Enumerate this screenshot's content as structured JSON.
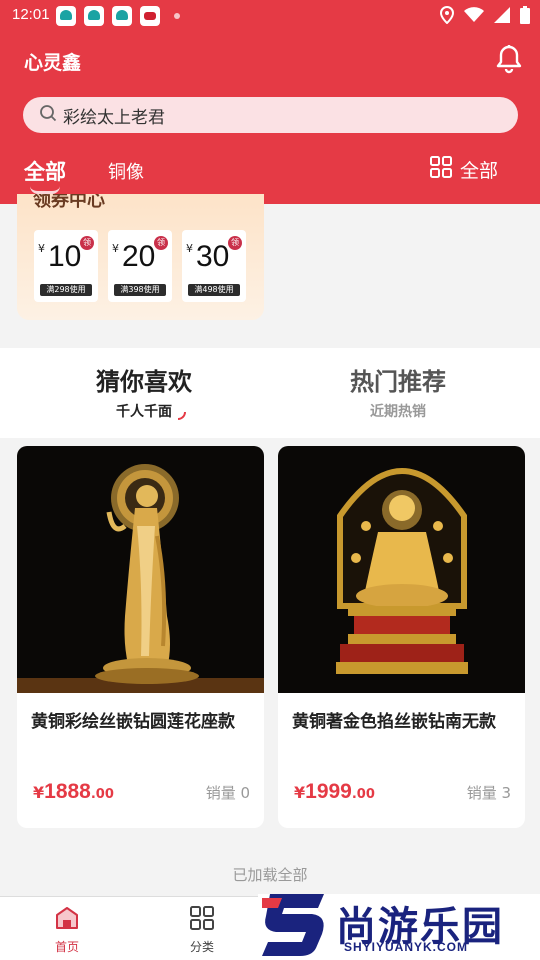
{
  "status": {
    "time": "12:01"
  },
  "header": {
    "title": "心灵鑫",
    "search_value": "彩绘太上老君",
    "tabs": [
      "全部",
      "铜像"
    ],
    "grid_label": "全部"
  },
  "coupon": {
    "title": "领券中心",
    "yen": "¥",
    "tag": "领",
    "items": [
      {
        "amount": "10",
        "condition": "满298使用"
      },
      {
        "amount": "20",
        "condition": "满398使用"
      },
      {
        "amount": "30",
        "condition": "满498使用"
      }
    ]
  },
  "feed": {
    "tabs": [
      {
        "title": "猜你喜欢",
        "sub": "千人千面"
      },
      {
        "title": "热门推荐",
        "sub": "近期热销"
      }
    ],
    "products": [
      {
        "name": "黄铜彩绘丝嵌钻圆莲花座款",
        "currency": "¥",
        "price_int": "1888",
        "price_dec": ".00",
        "sales": "销量 0"
      },
      {
        "name": "黄铜著金色掐丝嵌钻南无款",
        "currency": "¥",
        "price_int": "1999",
        "price_dec": ".00",
        "sales": "销量 3"
      }
    ],
    "loaded_text": "已加载全部"
  },
  "nav": {
    "home": "首页",
    "category": "分类"
  },
  "watermark": {
    "text": "尚游乐园",
    "sub": "SHYIYUANYK.COM"
  },
  "colors": {
    "brand_red": "#e53a45",
    "watermark_blue": "#1a237e"
  }
}
